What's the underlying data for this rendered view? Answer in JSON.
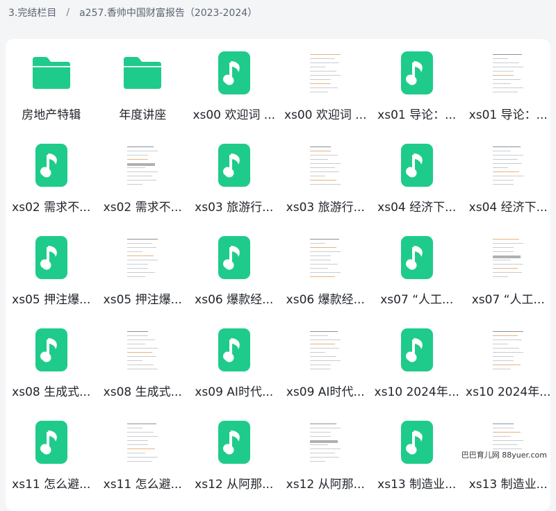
{
  "breadcrumb": {
    "parent": "3.完结栏目",
    "separator": "/",
    "current": "a257.香帅中国财富报告（2023-2024）"
  },
  "colors": {
    "accent": "#1fcb8a",
    "folder": "#1fcb8a"
  },
  "files": [
    {
      "name": "房地产特辑",
      "type": "folder"
    },
    {
      "name": "年度讲座",
      "type": "folder"
    },
    {
      "name": "xs00 欢迎词 ...",
      "type": "audio"
    },
    {
      "name": "xs00 欢迎词 ...",
      "type": "document"
    },
    {
      "name": "xs01 导论：...",
      "type": "audio"
    },
    {
      "name": "xs01 导论：...",
      "type": "document"
    },
    {
      "name": "xs02 需求不...",
      "type": "audio"
    },
    {
      "name": "xs02 需求不...",
      "type": "document"
    },
    {
      "name": "xs03 旅游行...",
      "type": "audio"
    },
    {
      "name": "xs03 旅游行...",
      "type": "document"
    },
    {
      "name": "xs04 经济下...",
      "type": "audio"
    },
    {
      "name": "xs04 经济下...",
      "type": "document"
    },
    {
      "name": "xs05 押注爆...",
      "type": "audio"
    },
    {
      "name": "xs05 押注爆...",
      "type": "document"
    },
    {
      "name": "xs06 爆款经...",
      "type": "audio"
    },
    {
      "name": "xs06 爆款经...",
      "type": "document"
    },
    {
      "name": "xs07 “人工...",
      "type": "audio"
    },
    {
      "name": "xs07 “人工...",
      "type": "document"
    },
    {
      "name": "xs08 生成式...",
      "type": "audio"
    },
    {
      "name": "xs08 生成式...",
      "type": "document"
    },
    {
      "name": "xs09 AI时代...",
      "type": "audio"
    },
    {
      "name": "xs09 AI时代...",
      "type": "document"
    },
    {
      "name": "xs10 2024年...",
      "type": "audio"
    },
    {
      "name": "xs10 2024年...",
      "type": "document"
    },
    {
      "name": "xs11 怎么避...",
      "type": "audio"
    },
    {
      "name": "xs11 怎么避...",
      "type": "document"
    },
    {
      "name": "xs12 从阿那...",
      "type": "audio"
    },
    {
      "name": "xs12 从阿那...",
      "type": "document"
    },
    {
      "name": "xs13 制造业...",
      "type": "audio"
    },
    {
      "name": "xs13 制造业...",
      "type": "document"
    }
  ],
  "watermark": "巴巴育儿网 88yuer.com"
}
